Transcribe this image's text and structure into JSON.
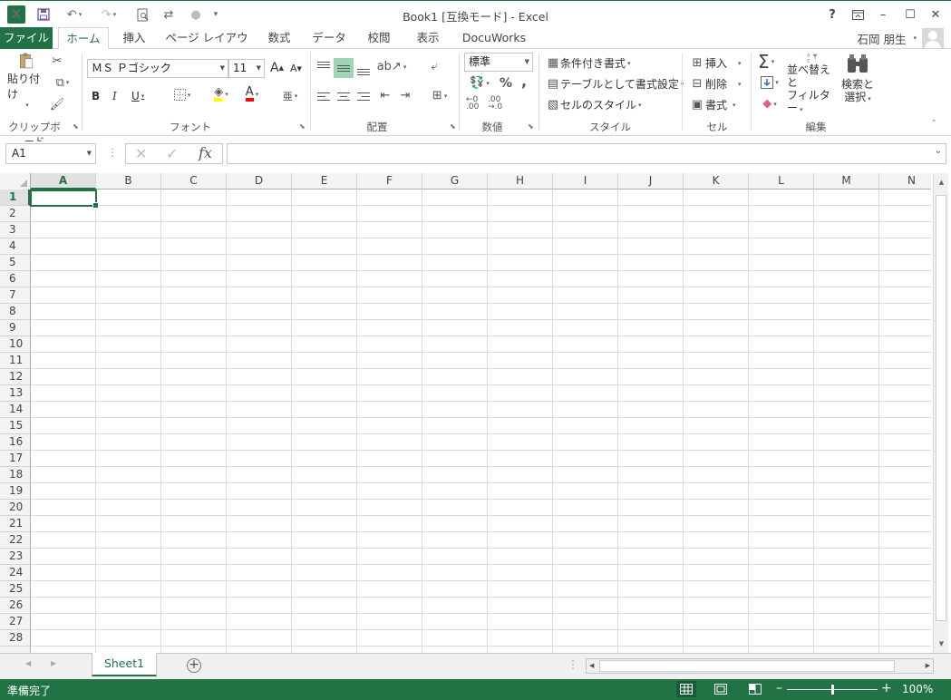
{
  "window": {
    "app_icon": "X",
    "title": "Book1  [互換モード] - Excel",
    "help": "?",
    "ribbon_display_icon": "ribbon-display-options-icon",
    "minimize": "–",
    "maximize": "☐",
    "close": "✕"
  },
  "quick_access": {
    "save_icon": "save-icon",
    "undo_icon": "undo-icon",
    "redo_icon": "redo-icon",
    "print_preview_icon": "print-preview-icon",
    "customize": "▾"
  },
  "tabs": [
    {
      "label": "ファイル"
    },
    {
      "label": "ホーム"
    },
    {
      "label": "挿入"
    },
    {
      "label": "ページ レイアウト"
    },
    {
      "label": "数式"
    },
    {
      "label": "データ"
    },
    {
      "label": "校閲"
    },
    {
      "label": "表示"
    },
    {
      "label": "DocuWorks"
    }
  ],
  "user": {
    "name": "石岡 朋生",
    "caret": "▾"
  },
  "ribbon": {
    "clipboard": {
      "label": "クリップボード",
      "paste": "貼り付け"
    },
    "font": {
      "label": "フォント",
      "font_name": "ＭＳ Ｐゴシック",
      "font_size": "11",
      "grow": "A",
      "shrink": "A",
      "bold": "B",
      "italic": "I",
      "underline": "U",
      "font_color_letter": "A",
      "phonetic": "亜"
    },
    "alignment": {
      "label": "配置"
    },
    "number": {
      "label": "数値",
      "format": "標準",
      "percent": "%",
      "comma": ","
    },
    "styles": {
      "label": "スタイル",
      "conditional": "条件付き書式",
      "table": "テーブルとして書式設定",
      "cell_styles": "セルのスタイル"
    },
    "cells": {
      "label": "セル",
      "insert": "挿入",
      "delete": "削除",
      "format": "書式"
    },
    "editing": {
      "label": "編集",
      "autosum": "Σ",
      "sort_line1": "並べ替えと",
      "sort_line2": "フィルター",
      "find_line1": "検索と",
      "find_line2": "選択"
    }
  },
  "formula_bar": {
    "name_box": "A1",
    "fx": "fx",
    "cancel": "✕",
    "enter": "✓",
    "value": ""
  },
  "grid": {
    "columns": [
      "A",
      "B",
      "C",
      "D",
      "E",
      "F",
      "G",
      "H",
      "I",
      "J",
      "K",
      "L",
      "M",
      "N"
    ],
    "rows": [
      "1",
      "2",
      "3",
      "4",
      "5",
      "6",
      "7",
      "8",
      "9",
      "10",
      "11",
      "12",
      "13",
      "14",
      "15",
      "16",
      "17",
      "18",
      "19",
      "20",
      "21",
      "22",
      "23",
      "24",
      "25",
      "26",
      "27",
      "28"
    ],
    "active_cell": "A1"
  },
  "sheets": [
    {
      "name": "Sheet1",
      "active": true
    }
  ],
  "add_sheet": "+",
  "status": {
    "text": "準備完了",
    "zoom": "100%",
    "zoom_minus": "–",
    "zoom_plus": "+"
  },
  "colors": {
    "accent": "#217346"
  }
}
